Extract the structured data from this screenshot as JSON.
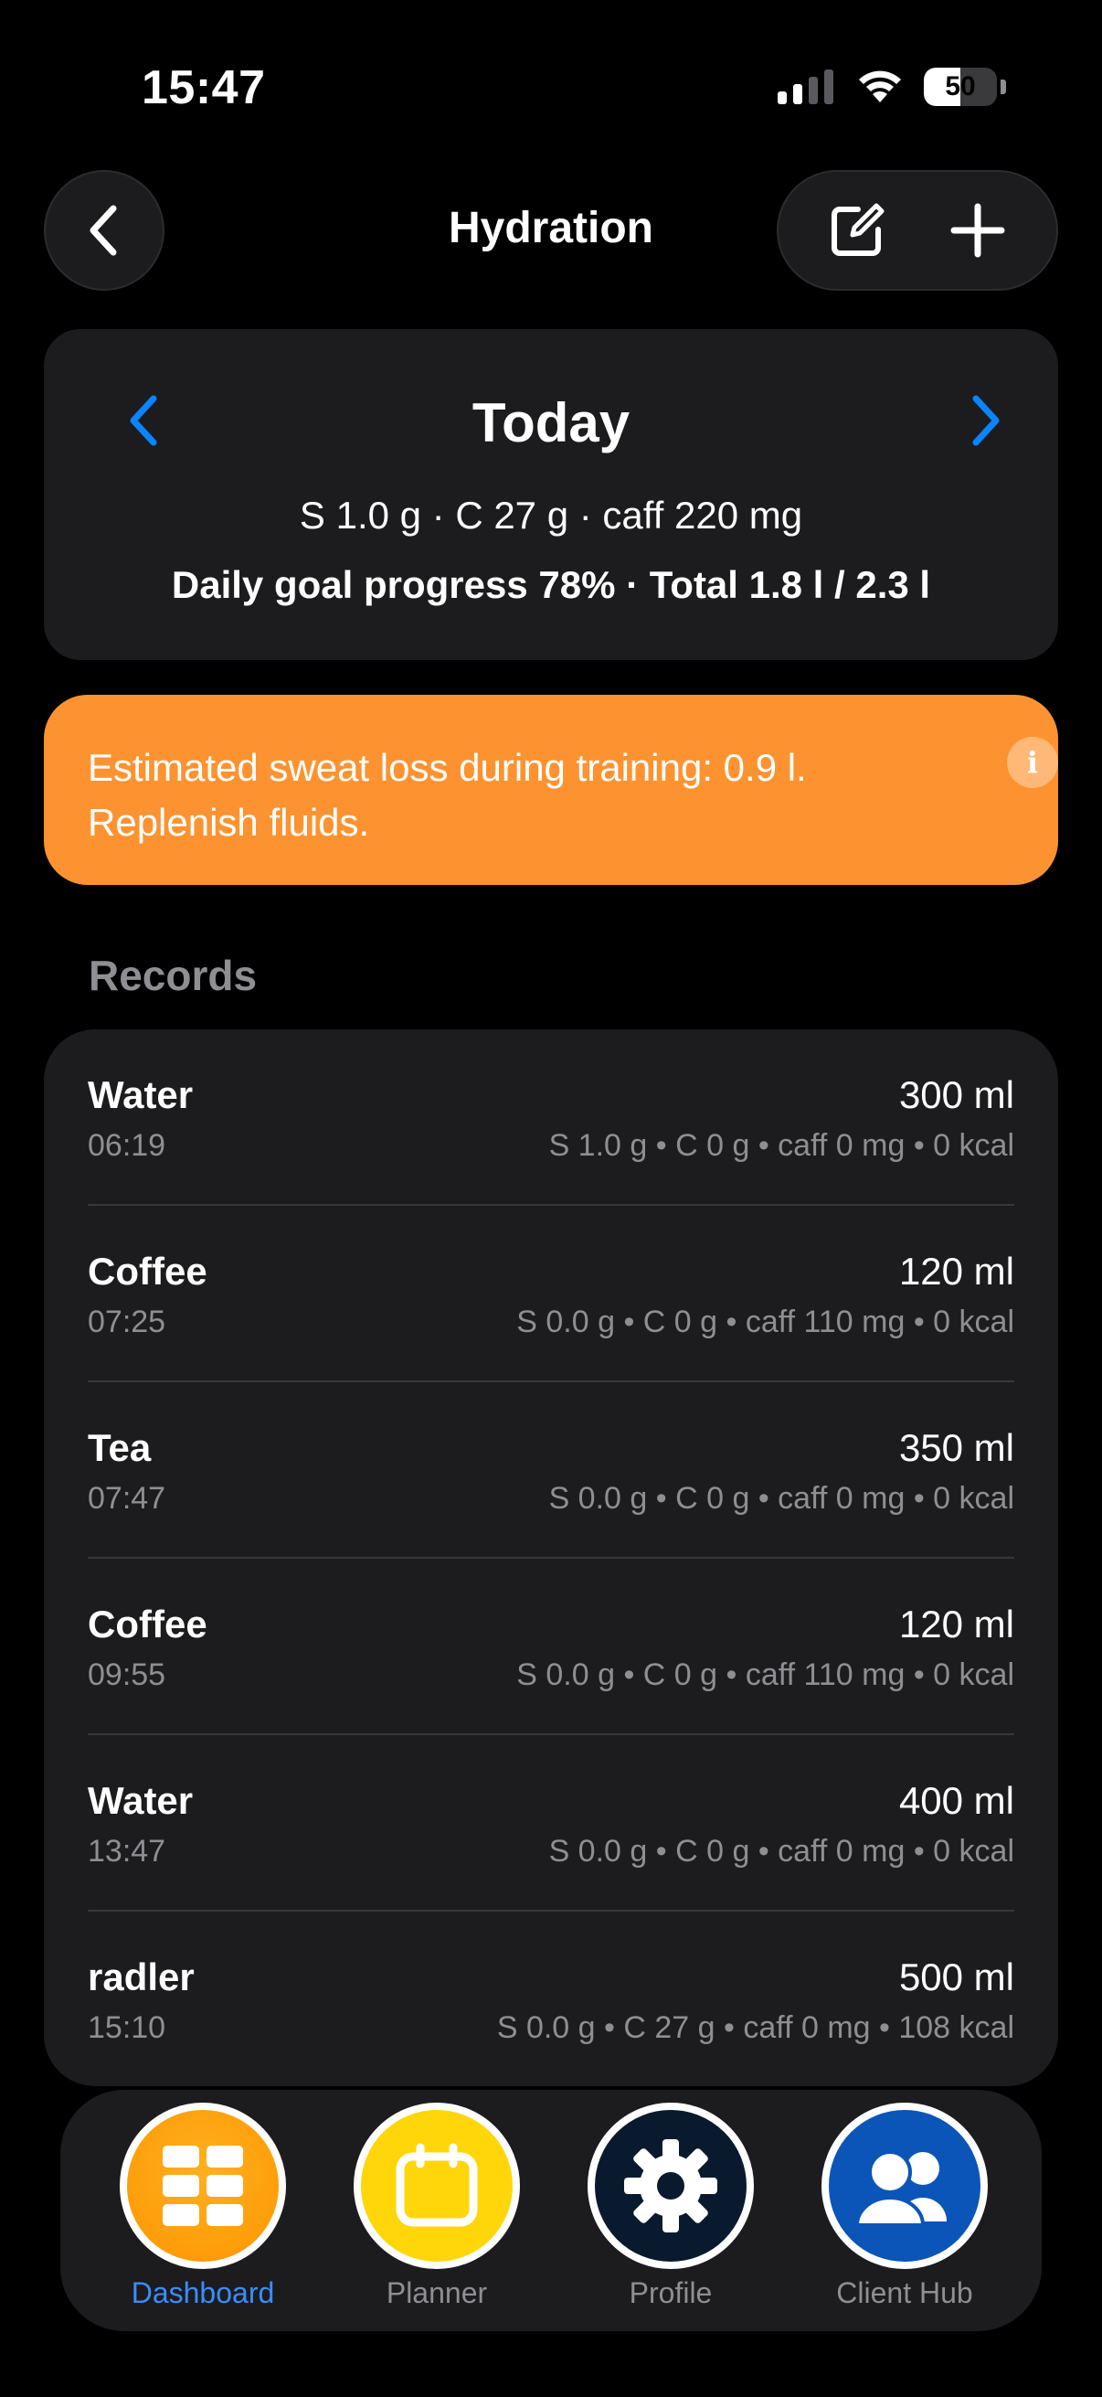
{
  "status": {
    "time": "15:47",
    "battery": "50",
    "battery_level": 0.5
  },
  "nav": {
    "title": "Hydration"
  },
  "day": {
    "title": "Today",
    "summary": "S 1.0 g · C 27 g · caff 220 mg",
    "progress": "Daily goal progress 78% · Total 1.8 l / 2.3 l"
  },
  "alert": {
    "text": "Estimated sweat loss during training: 0.9 l. Replenish fluids.",
    "info_glyph": "i"
  },
  "records": {
    "title": "Records",
    "items": [
      {
        "name": "Water",
        "time": "06:19",
        "amount": "300 ml",
        "detail": "S 1.0 g • C 0 g • caff 0 mg • 0 kcal"
      },
      {
        "name": "Coffee",
        "time": "07:25",
        "amount": "120 ml",
        "detail": "S 0.0 g • C 0 g • caff 110 mg • 0 kcal"
      },
      {
        "name": "Tea",
        "time": "07:47",
        "amount": "350 ml",
        "detail": "S 0.0 g • C 0 g • caff 0 mg • 0 kcal"
      },
      {
        "name": "Coffee",
        "time": "09:55",
        "amount": "120 ml",
        "detail": "S 0.0 g • C 0 g • caff 110 mg • 0 kcal"
      },
      {
        "name": "Water",
        "time": "13:47",
        "amount": "400 ml",
        "detail": "S 0.0 g • C 0 g • caff 0 mg • 0 kcal"
      },
      {
        "name": "radler",
        "time": "15:10",
        "amount": "500 ml",
        "detail": "S 0.0 g • C 27 g • caff 0 mg • 108 kcal"
      }
    ]
  },
  "tabs": [
    {
      "label": "Dashboard",
      "icon": "grid-icon",
      "color": "#ff9d0a",
      "active": true
    },
    {
      "label": "Planner",
      "icon": "calendar-icon",
      "color": "#ffd60a",
      "active": false
    },
    {
      "label": "Profile",
      "icon": "gear-icon",
      "color": "#0a1a2e",
      "active": false
    },
    {
      "label": "Client Hub",
      "icon": "people-icon",
      "color": "#0b55b8",
      "active": false
    }
  ],
  "colors": {
    "accent": "#0a84ff",
    "alert": "#fd9330",
    "card": "#1c1c1e",
    "active_tab": "#3a8dff"
  }
}
